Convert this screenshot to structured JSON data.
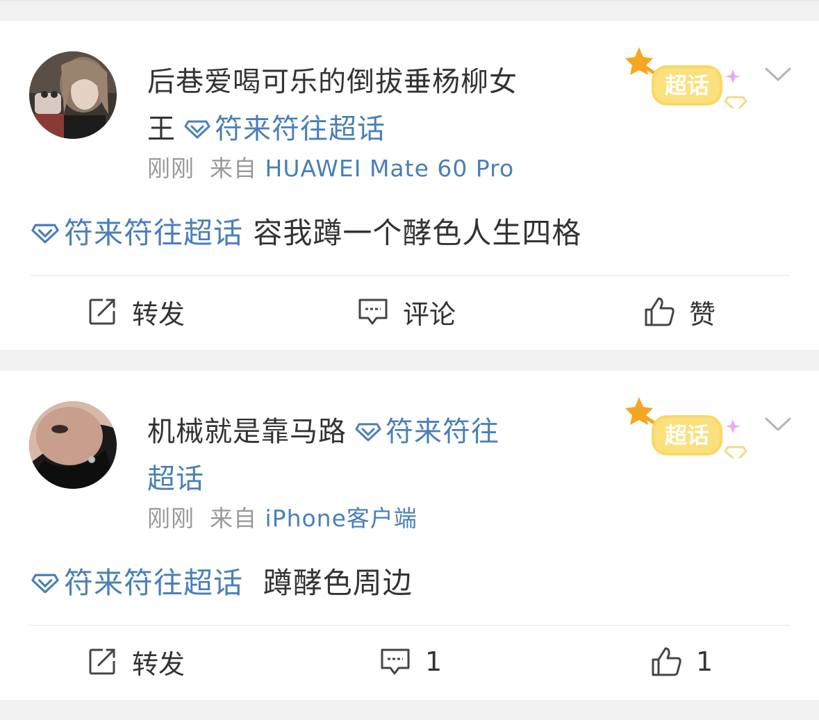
{
  "posts": [
    {
      "username_line1": "后巷爱喝可乐的倒拔垂杨柳女",
      "username_line2": "王",
      "topic_name": "符来符往超话",
      "time": "刚刚",
      "source_prefix": "来自",
      "device": "HUAWEI Mate 60 Pro",
      "badge_label": "超话",
      "content_topic": "符来符往超话",
      "content_text": "容我蹲一个酵色人生四格",
      "repost_label": "转发",
      "comment_label": "评论",
      "like_label": "赞"
    },
    {
      "username": "机械就是靠马路",
      "topic_name_part1": "符来符往",
      "topic_name_part2": "超话",
      "time": "刚刚",
      "source_prefix": "来自",
      "device": "iPhone客户端",
      "badge_label": "超话",
      "content_topic": "符来符往超话",
      "content_text": "蹲酵色周边",
      "repost_label": "转发",
      "comment_count": "1",
      "like_count": "1"
    }
  ],
  "colors": {
    "link": "#4a7fb8",
    "text": "#333333",
    "meta": "#9a9a9a",
    "badge": "#f7c94a",
    "background": "#f2f2f2"
  },
  "icons": [
    "super-topic-diamond-icon",
    "chevron-down-icon",
    "repost-icon",
    "comment-icon",
    "like-icon"
  ]
}
